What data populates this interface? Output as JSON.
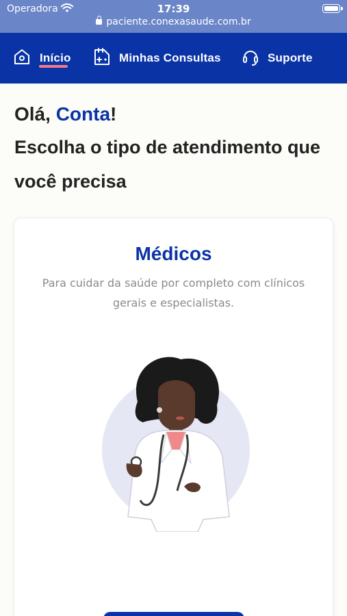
{
  "status_bar": {
    "carrier": "Operadora",
    "time": "17:39",
    "url": "paciente.conexasaude.com.br"
  },
  "nav": {
    "items": [
      {
        "label": "Início",
        "icon": "home-icon",
        "active": true
      },
      {
        "label": "Minhas Consultas",
        "icon": "calendar-icon"
      },
      {
        "label": "Suporte",
        "icon": "headset-icon"
      }
    ],
    "active_underline_color": "#f27b89"
  },
  "greeting": {
    "hello_prefix": "Olá, ",
    "name": "Conta",
    "hello_suffix": "!",
    "line1": "Escolha o tipo de atendimento que",
    "line2": "você precisa"
  },
  "card": {
    "title": "Médicos",
    "description": "Para cuidar da saúde por completo com clínicos gerais e especialistas.",
    "illustration": "doctor-with-stethoscope"
  },
  "colors": {
    "brand_blue": "#0a33a6",
    "status_bar": "#6b86c8",
    "background": "#fcfcf8"
  }
}
